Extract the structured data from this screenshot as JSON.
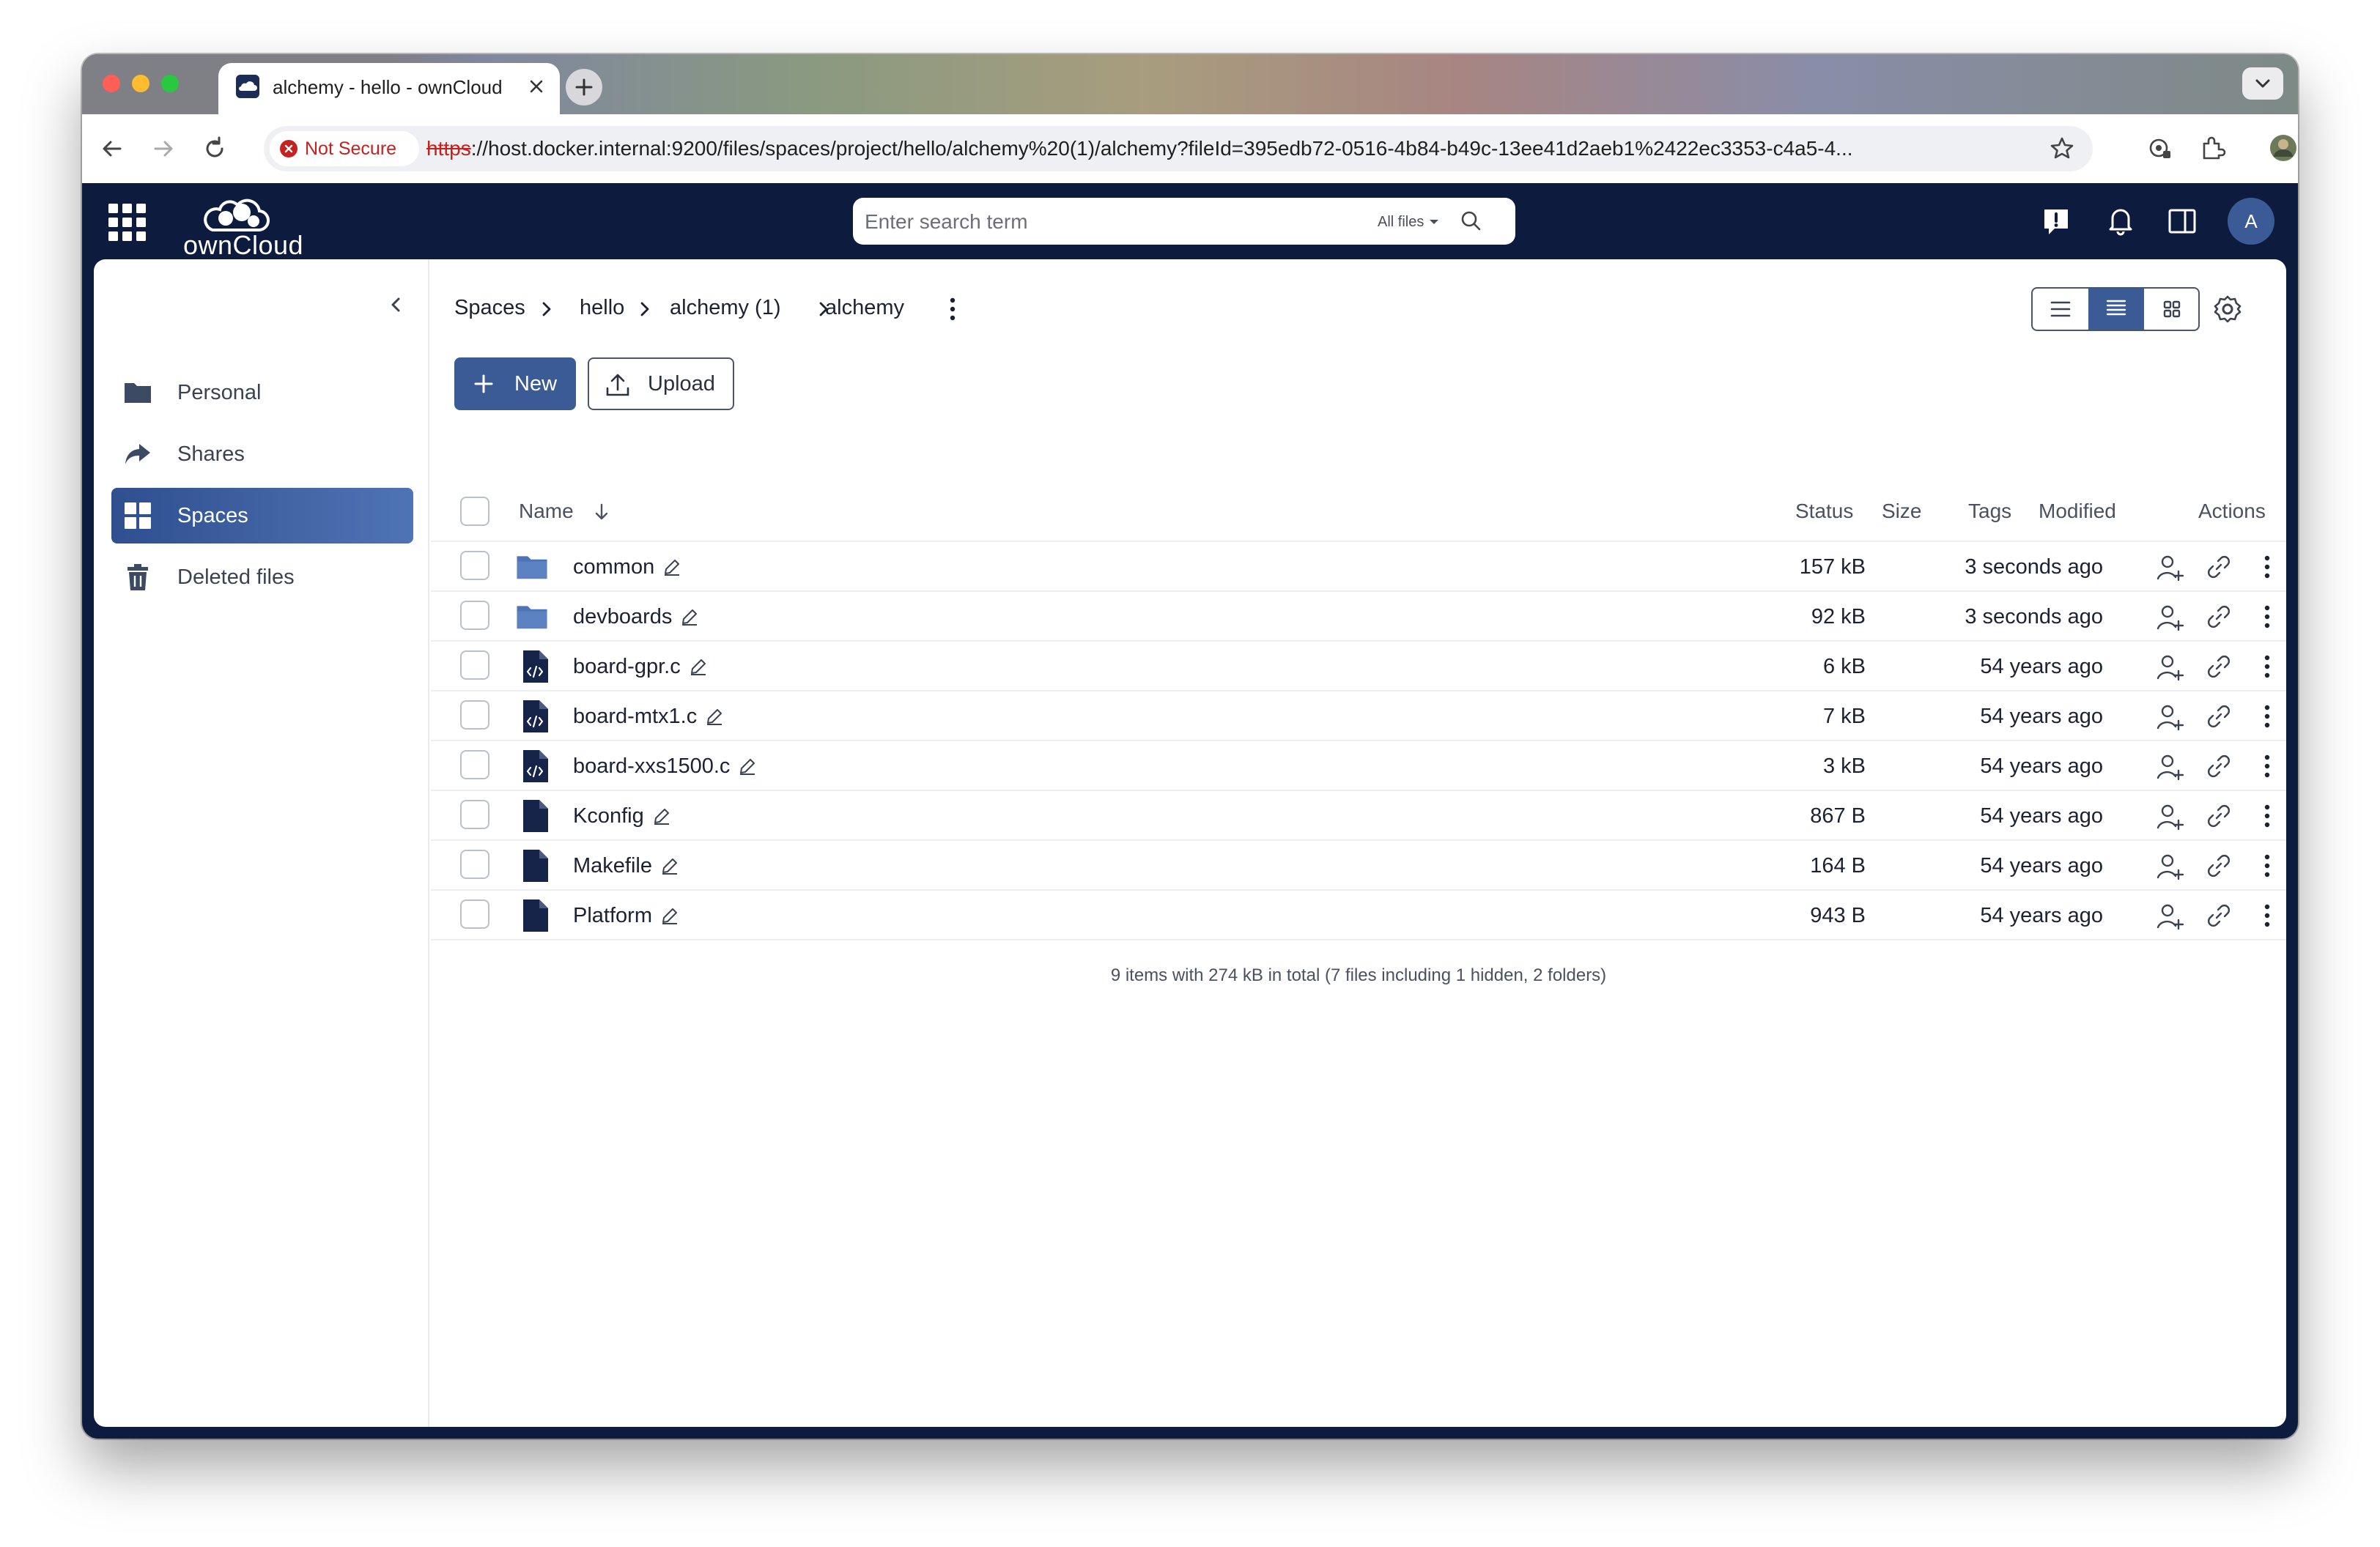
{
  "browser": {
    "tab_title": "alchemy - hello - ownCloud",
    "security": "Not Secure",
    "url_scheme": "https",
    "url_rest": "://host.docker.internal:9200/files/spaces/project/hello/alchemy%20(1)/alchemy?fileId=395edb72-0516-4b84-b49c-13ee41d2aeb1%2422ec3353-c4a5-4..."
  },
  "app": {
    "logo_text": "ownCloud",
    "search_placeholder": "Enter search term",
    "search_scope": "All files",
    "avatar_initial": "A"
  },
  "sidebar": {
    "items": [
      {
        "label": "Personal",
        "icon": "folder-icon"
      },
      {
        "label": "Shares",
        "icon": "share-icon"
      },
      {
        "label": "Spaces",
        "icon": "grid-icon",
        "active": true
      },
      {
        "label": "Deleted files",
        "icon": "trash-icon"
      }
    ]
  },
  "breadcrumb": [
    "Spaces",
    "hello",
    "alchemy (1)",
    "alchemy"
  ],
  "toolbar": {
    "new_label": "New",
    "upload_label": "Upload"
  },
  "columns": {
    "name": "Name",
    "status": "Status",
    "size": "Size",
    "tags": "Tags",
    "modified": "Modified",
    "actions": "Actions"
  },
  "files": [
    {
      "name": "common",
      "type": "folder",
      "size": "157 kB",
      "modified": "3 seconds ago"
    },
    {
      "name": "devboards",
      "type": "folder",
      "size": "92 kB",
      "modified": "3 seconds ago"
    },
    {
      "name": "board-gpr.c",
      "type": "code",
      "size": "6 kB",
      "modified": "54 years ago"
    },
    {
      "name": "board-mtx1.c",
      "type": "code",
      "size": "7 kB",
      "modified": "54 years ago"
    },
    {
      "name": "board-xxs1500.c",
      "type": "code",
      "size": "3 kB",
      "modified": "54 years ago"
    },
    {
      "name": "Kconfig",
      "type": "file",
      "size": "867 B",
      "modified": "54 years ago"
    },
    {
      "name": "Makefile",
      "type": "file",
      "size": "164 B",
      "modified": "54 years ago"
    },
    {
      "name": "Platform",
      "type": "file",
      "size": "943 B",
      "modified": "54 years ago"
    }
  ],
  "footer": "9 items with 274 kB in total (7 files including 1 hidden, 2 folders)",
  "colors": {
    "navy": "#0d1b3e",
    "accent": "#3b5b97",
    "danger": "#c5221f"
  }
}
